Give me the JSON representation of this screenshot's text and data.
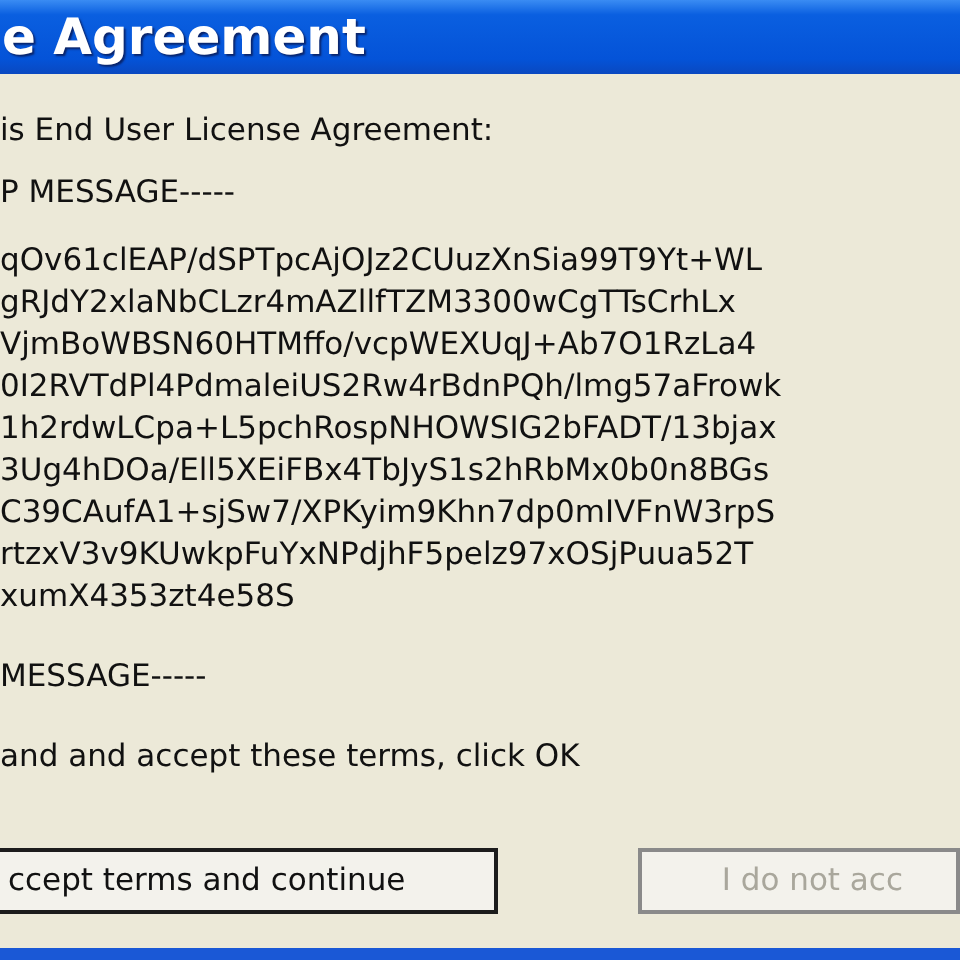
{
  "window": {
    "title": "e Agreement"
  },
  "intro": "is End User License Agreement:",
  "begin_marker": "P MESSAGE-----",
  "message_lines": [
    "qOv61clEAP/dSPTpcAjOJz2CUuzXnSia99T9Yt+WL",
    "gRJdY2xlaNbCLzr4mAZllfTZM3300wCgTTsCrhLx",
    "VjmBoWBSN60HTMffo/vcpWEXUqJ+Ab7O1RzLa4",
    "0I2RVTdPl4PdmaleiUS2Rw4rBdnPQh/lmg57aFrowk",
    "1h2rdwLCpa+L5pchRospNHOWSIG2bFADT/13bjax",
    "3Ug4hDOa/Ell5XEiFBx4TbJyS1s2hRbMx0b0n8BGs",
    "C39CAufA1+sjSw7/XPKyim9Khn7dp0mIVFnW3rpS",
    "rtzxV3v9KUwkpFuYxNPdjhF5pelz97xOSjPuua52T",
    "xumX4353zt4e58S"
  ],
  "end_marker": "MESSAGE-----",
  "instruction": "and and accept these terms, click OK",
  "buttons": [
    {
      "label": "ccept terms and continue",
      "disabled": false
    },
    {
      "label": "I do not acc",
      "disabled": true
    }
  ]
}
